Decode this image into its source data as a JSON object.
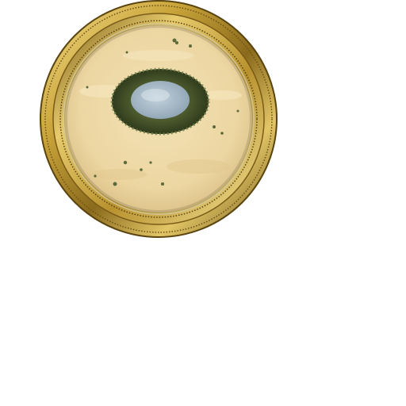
{
  "minimap": {
    "terrain": "desert",
    "feature": "oasis-pond",
    "frame_style": "ornate-gold-ring",
    "colors": {
      "sand": "#ecd6a2",
      "sand_light": "#f3e2b6",
      "sand_shadow": "#d8bd82",
      "vegetation": "#4c5a2e",
      "vegetation_dark": "#2f3b1c",
      "water": "#9fb3c2",
      "water_light": "#c4d2dc",
      "gold": "#c9a43a",
      "gold_light": "#f5df8c",
      "gold_dark": "#6b5215"
    }
  }
}
